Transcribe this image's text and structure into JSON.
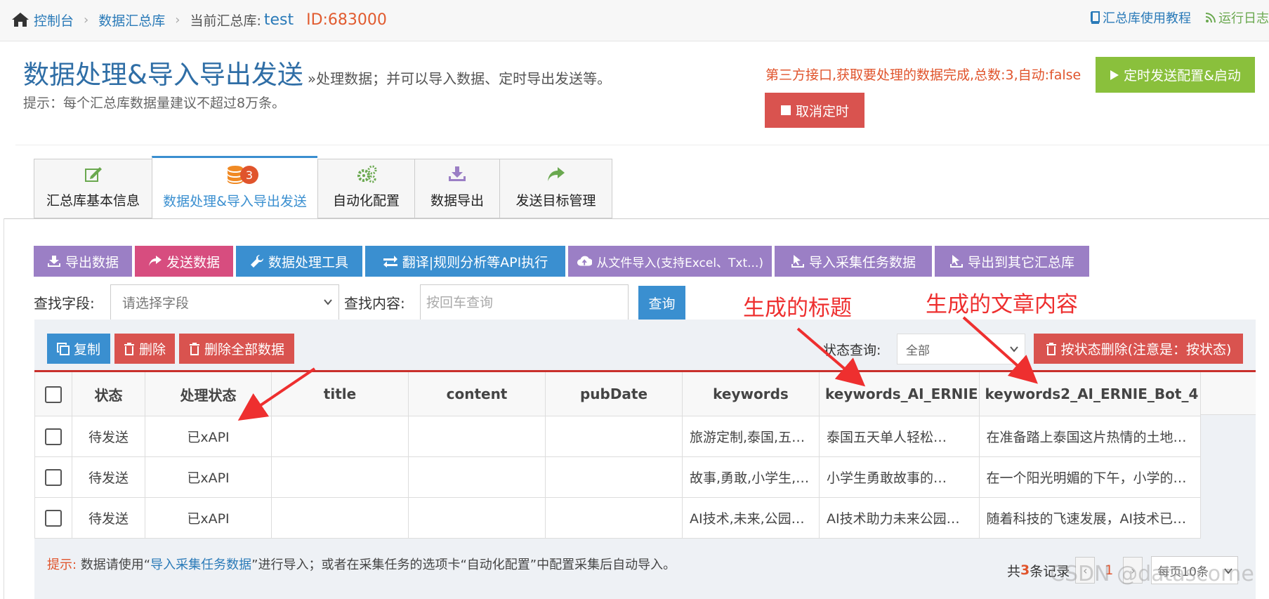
{
  "breadcrumb": {
    "home": "控制台",
    "library": "数据汇总库",
    "current_label": "当前汇总库:",
    "current_name": "test",
    "current_id": "ID:683000"
  },
  "top_links": {
    "tutorial": "汇总库使用教程",
    "log": "运行日志"
  },
  "header": {
    "title": "数据处理&导入导出发送",
    "subtitle": "»处理数据；并可以导入数据、定时导出发送等。",
    "hint": "提示：每个汇总库数据量建议不超过8万条。",
    "status_message": "第三方接口,获取要处理的数据完成,总数:3,自动:false",
    "timer_button": "定时发送配置&启动",
    "cancel_button": "取消定时"
  },
  "tabs": [
    {
      "label": "汇总库基本信息",
      "icon": "edit-icon",
      "color": "#6aa84f"
    },
    {
      "label": "数据处理&导入导出发送",
      "icon": "database-icon",
      "color": "#f08a24",
      "badge": "3",
      "active": true
    },
    {
      "label": "自动化配置",
      "icon": "gears-icon",
      "color": "#6aa84f"
    },
    {
      "label": "数据导出",
      "icon": "download-icon",
      "color": "#9b7fc5"
    },
    {
      "label": "发送目标管理",
      "icon": "share-icon",
      "color": "#6aa84f"
    }
  ],
  "toolbar": {
    "export": "导出数据",
    "send": "发送数据",
    "tools": "数据处理工具",
    "api": "翻译|规则分析等API执行",
    "import_file": "从文件导入(支持Excel、Txt...)",
    "import_task": "导入采集任务数据",
    "export_other": "导出到其它汇总库"
  },
  "search": {
    "field_label": "查找字段:",
    "field_placeholder": "请选择字段",
    "content_label": "查找内容:",
    "content_placeholder": "按回车查询",
    "query_button": "查询"
  },
  "annotations": {
    "title_note": "生成的标题",
    "content_note": "生成的文章内容"
  },
  "table_tools": {
    "copy": "复制",
    "delete": "删除",
    "delete_all": "删除全部数据",
    "state_label": "状态查询:",
    "state_value": "全部",
    "delete_by_state": "按状态删除(注意是：按状态)"
  },
  "table": {
    "columns": [
      "状态",
      "处理状态",
      "title",
      "content",
      "pubDate",
      "keywords",
      "keywords_AI_ERNIE",
      "keywords2_AI_ERNIE_Bot_4"
    ],
    "rows": [
      [
        "待发送",
        "已xAPI",
        "",
        "",
        "",
        "旅游定制,泰国,五…",
        "泰国五天单人轻松…",
        "在准备踏上泰国这片热情的土地…"
      ],
      [
        "待发送",
        "已xAPI",
        "",
        "",
        "",
        "故事,勇敢,小学生,…",
        "小学生勇敢故事的…",
        "在一个阳光明媚的下午，小学的…"
      ],
      [
        "待发送",
        "已xAPI",
        "",
        "",
        "",
        "AI技术,未来,公园…",
        "AI技术助力未来公园…",
        "随着科技的飞速发展，AI技术已…"
      ]
    ]
  },
  "footer": {
    "tip_label": "提示:",
    "tip_text1": "数据请使用“",
    "tip_link": "导入采集任务数据",
    "tip_text2": "”进行导入；或者在采集任务的选项卡“自动化配置”中配置采集后自动导入。",
    "total_prefix": "共",
    "total_count": "3",
    "total_suffix": "条记录",
    "current_page": "1",
    "page_size": "每页10条"
  },
  "watermark": "CSDN @datascome",
  "colors": {
    "accent_blue": "#3a8fd0",
    "danger": "#d9534f",
    "success": "#8ac03c",
    "purple": "#9b7fc5",
    "pink": "#d74d7f",
    "annotation": "#ee2f2f"
  }
}
